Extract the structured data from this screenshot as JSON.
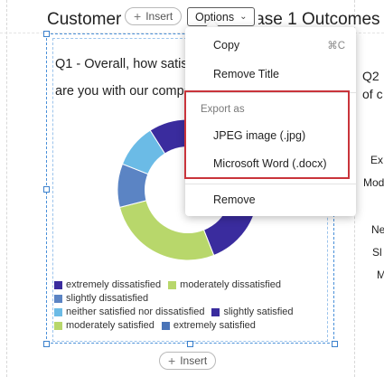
{
  "header": {
    "title": "Customer Satisfaction – Phase 1 Outcomes",
    "insert_label": "Insert",
    "options_label": "Options"
  },
  "widget": {
    "question_line1": "Q1 - Overall, how satisfied",
    "question_line2": "are you with our company?",
    "chart_data": {
      "type": "pie",
      "style": "donut",
      "slices": [
        {
          "label": "extremely dissatisfied",
          "share": 0.27,
          "color": "#3a2c9e"
        },
        {
          "label": "moderately dissatisfied",
          "share": 0.27,
          "color": "#b8d76b"
        },
        {
          "label": "slightly dissatisfied",
          "share": 0.1,
          "color": "#5b84c4"
        },
        {
          "label": "neither satisfied nor dissatisfied",
          "share": 0.1,
          "color": "#6bbbe6"
        },
        {
          "label": "slightly satisfied",
          "share": 0.1,
          "color": "#3a2c9e"
        },
        {
          "label": "moderately satisfied",
          "share": 0.16,
          "color": "#b8d76b"
        }
      ]
    },
    "legend": [
      {
        "label": "extremely dissatisfied",
        "color": "#3a2c9e"
      },
      {
        "label": "moderately dissatisfied",
        "color": "#b8d76b"
      },
      {
        "label": "slightly dissatisfied",
        "color": "#5b84c4"
      },
      {
        "label": "neither satisfied nor dissatisfied",
        "color": "#6bbbe6"
      },
      {
        "label": "slightly satisfied",
        "color": "#3a2c9e"
      },
      {
        "label": "moderately satisfied",
        "color": "#b8d76b"
      },
      {
        "label": "extremely satisfied",
        "color": "#4a74b8"
      }
    ],
    "insert_below_label": "Insert"
  },
  "right_widget": {
    "question_line1": "Q2",
    "question_line2": "of c",
    "labels": [
      "Ex",
      "Mod",
      "Ne",
      "Sl",
      "M"
    ]
  },
  "menu": {
    "copy_label": "Copy",
    "copy_shortcut": "⌘C",
    "remove_title_label": "Remove Title",
    "export_header": "Export as",
    "jpeg_label": "JPEG image (.jpg)",
    "docx_label": "Microsoft Word (.docx)",
    "remove_label": "Remove"
  }
}
